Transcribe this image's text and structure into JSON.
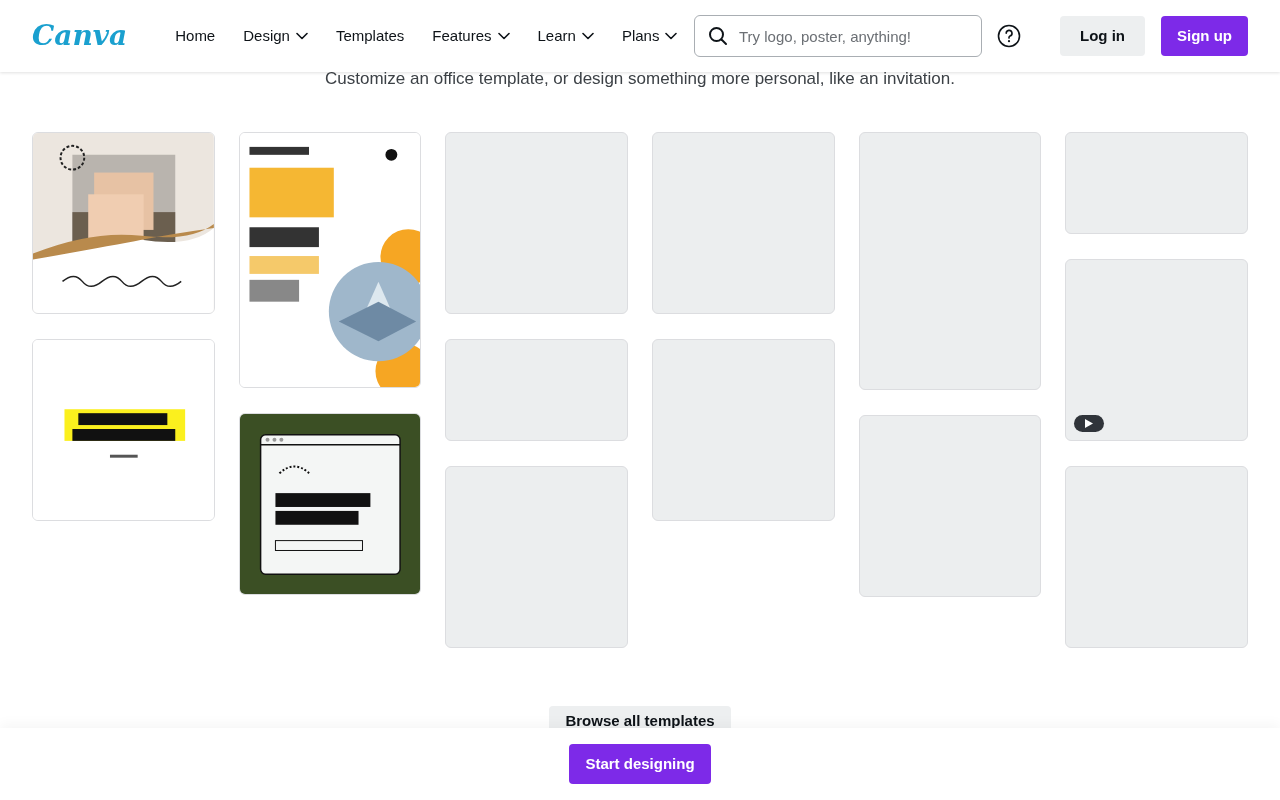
{
  "header": {
    "logo": "Canva",
    "nav": [
      {
        "label": "Home",
        "has_menu": false
      },
      {
        "label": "Design",
        "has_menu": true
      },
      {
        "label": "Templates",
        "has_menu": false
      },
      {
        "label": "Features",
        "has_menu": true
      },
      {
        "label": "Learn",
        "has_menu": true
      },
      {
        "label": "Plans",
        "has_menu": true
      }
    ],
    "search": {
      "placeholder": "Try logo, poster, anything!"
    },
    "login": "Log in",
    "signup": "Sign up"
  },
  "subtitle": "Customize an office template, or design something more personal, like an invitation.",
  "columns": [
    [
      {
        "kind": "picture"
      },
      {
        "kind": "picture"
      }
    ],
    [
      {
        "kind": "picture"
      },
      {
        "kind": "picture"
      }
    ],
    [
      {
        "kind": "placeholder",
        "video": false
      },
      {
        "kind": "placeholder",
        "video": false
      },
      {
        "kind": "placeholder",
        "video": false
      }
    ],
    [
      {
        "kind": "placeholder",
        "video": false
      },
      {
        "kind": "placeholder",
        "video": false
      }
    ],
    [
      {
        "kind": "placeholder",
        "video": false
      },
      {
        "kind": "placeholder",
        "video": false
      }
    ],
    [
      {
        "kind": "placeholder",
        "video": false
      },
      {
        "kind": "placeholder",
        "video": true
      },
      {
        "kind": "placeholder",
        "video": false
      }
    ]
  ],
  "browse_button": "Browse all templates",
  "start_button": "Start designing"
}
